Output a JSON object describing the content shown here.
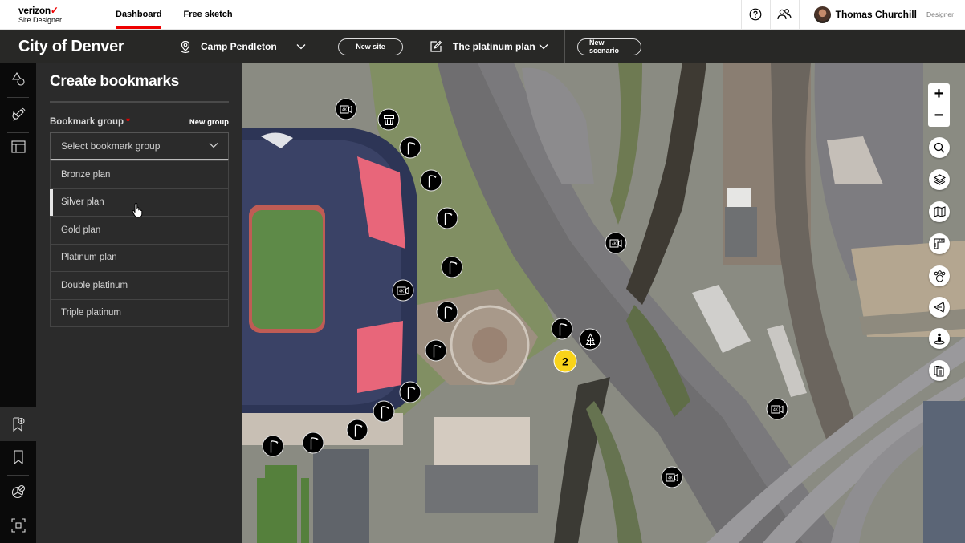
{
  "header": {
    "brand": "verizon",
    "brand_check": "✓",
    "product": "Site Designer",
    "tabs": [
      {
        "label": "Dashboard",
        "active": true
      },
      {
        "label": "Free sketch",
        "active": false
      }
    ],
    "help_icon": "help-circle-icon",
    "users_icon": "users-icon",
    "user": {
      "name": "Thomas Churchill",
      "role": "Designer"
    }
  },
  "scenario_bar": {
    "city": "City of Denver",
    "site": {
      "icon": "location-pin-icon",
      "label": "Camp Pendleton"
    },
    "new_site_label": "New site",
    "plan": {
      "icon": "edit-icon",
      "label": "The platinum plan"
    },
    "new_scenario_label": "New scenario"
  },
  "rail": {
    "top_items": [
      "shapes-icon",
      "satellite-icon",
      "layout-icon"
    ],
    "bottom_items": [
      "add-bookmark-icon",
      "bookmark-icon",
      "pie-chart-icon",
      "fullscreen-icon"
    ],
    "active": "add-bookmark-icon"
  },
  "panel": {
    "title": "Create bookmarks",
    "field_label": "Bookmark group",
    "required_mark": "*",
    "new_group_label": "New group",
    "select_placeholder": "Select bookmark group",
    "options": [
      "Bronze plan",
      "Silver plan",
      "Gold plan",
      "Platinum plan",
      "Double platinum",
      "Triple platinum"
    ],
    "hovered_option": "Silver plan"
  },
  "map_controls": {
    "zoom_in": "+",
    "zoom_out": "−",
    "tools": [
      "search-icon",
      "layers-icon",
      "map-icon",
      "ruler-icon",
      "group-icon",
      "viewshed-icon",
      "person-icon",
      "clipboard-icon"
    ]
  },
  "markers": {
    "cluster_count": "2",
    "camera_label": "4K",
    "colors": {
      "marker": "#000000",
      "cluster": "#f8d31a",
      "accent": "#ee0000"
    }
  }
}
